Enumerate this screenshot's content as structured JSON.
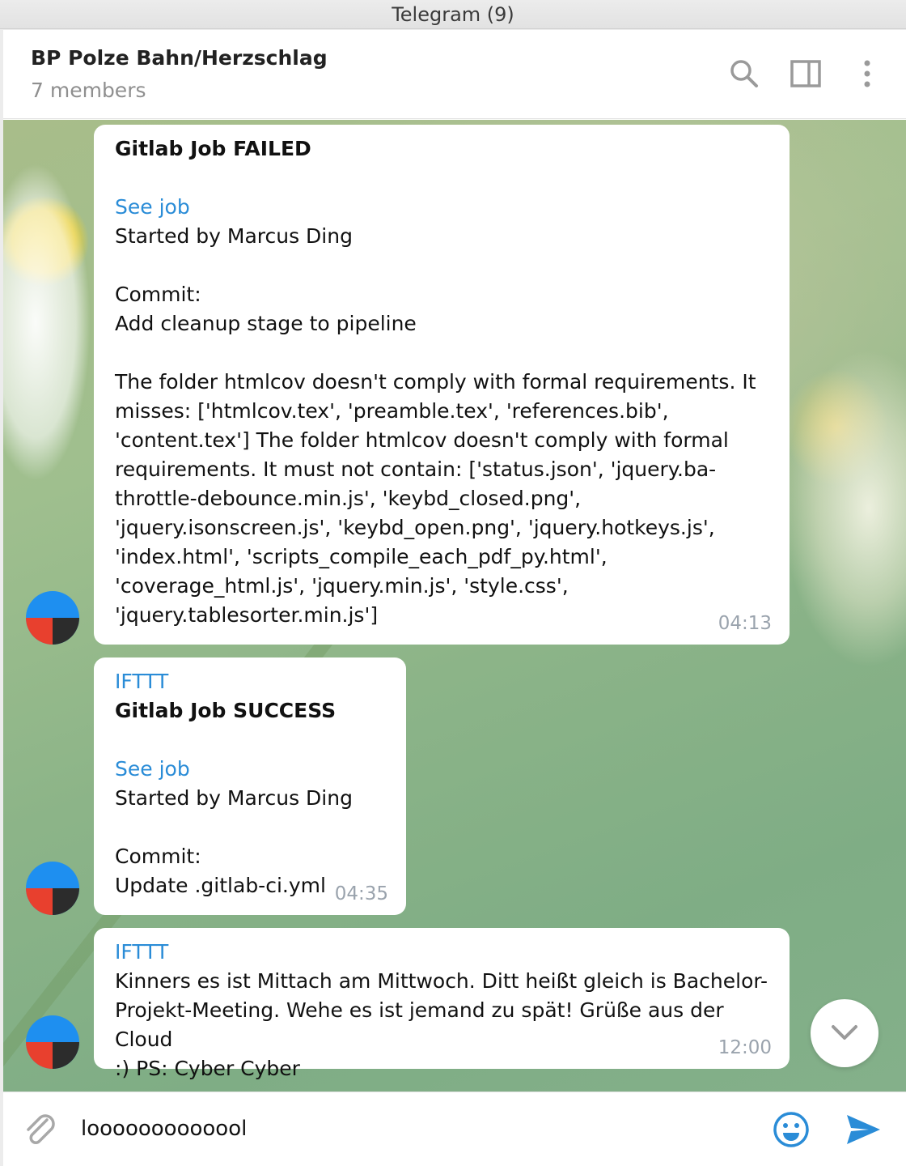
{
  "window": {
    "title": "Telegram (9)"
  },
  "header": {
    "chat_name": "BP Polze Bahn/Herzschlag",
    "members": "7 members",
    "icons": [
      "search-icon",
      "sidebar-toggle-icon",
      "more-vert-icon"
    ]
  },
  "messages": [
    {
      "title": "Gitlab Job FAILED",
      "link": "See job",
      "started_by": "Started by Marcus Ding",
      "commit_label": "Commit:",
      "commit_msg": "Add cleanup stage to pipeline",
      "body_lines": [
        "The folder htmlcov doesn't comply with formal requirements. It",
        "misses: ['htmlcov.tex', 'preamble.tex', 'references.bib',",
        "'content.tex'] The folder htmlcov doesn't comply with formal",
        "requirements. It must not contain: ['status.json', 'jquery.ba-",
        "throttle-debounce.min.js', 'keybd_closed.png',",
        "'jquery.isonscreen.js', 'keybd_open.png', 'jquery.hotkeys.js',",
        "'index.html', 'scripts_compile_each_pdf_py.html',",
        "'coverage_html.js', 'jquery.min.js', 'style.css',",
        "'jquery.tablesorter.min.js']"
      ],
      "time": "04:13"
    },
    {
      "sender": "IFTTT",
      "title": "Gitlab Job SUCCESS",
      "link": "See job",
      "started_by": "Started by Marcus Ding",
      "commit_label": "Commit:",
      "commit_msg": "Update .gitlab-ci.yml",
      "time": "04:35"
    },
    {
      "sender": "IFTTT",
      "body_lines": [
        "Kinners es ist Mittach am Mittwoch. Ditt heißt gleich is Bachelor-",
        "Projekt-Meeting. Wehe es ist jemand zu spät! Grüße aus der Cloud",
        ":) PS: Cyber Cyber"
      ],
      "time": "12:00"
    }
  ],
  "composer": {
    "value": "looooooooooool",
    "icons": [
      "paperclip-icon",
      "emoji-icon",
      "send-icon"
    ]
  },
  "colors": {
    "link": "#2a8cd7",
    "timestamp": "#9aa3ad",
    "avatar_blue": "#1e8ff0",
    "avatar_red": "#e8402e",
    "avatar_dark": "#2c2c2c"
  }
}
